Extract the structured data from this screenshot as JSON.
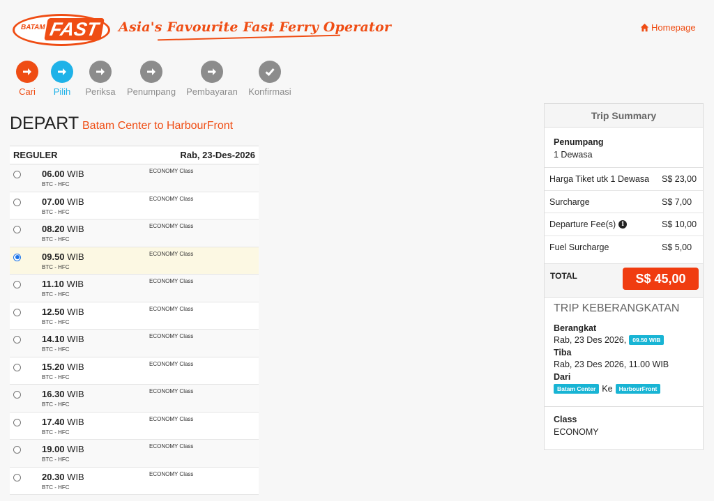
{
  "header": {
    "logo_small": "BATAM",
    "logo_big": "FAST",
    "tagline": "Asia's Favourite Fast Ferry Operator",
    "homepage_label": "Homepage",
    "homepage_icon": "home-icon"
  },
  "steps": [
    {
      "label": "Cari",
      "state": "done",
      "icon": "arrow-right-icon"
    },
    {
      "label": "Pilih",
      "state": "active",
      "icon": "arrow-right-icon"
    },
    {
      "label": "Periksa",
      "state": "pending",
      "icon": "arrow-right-icon"
    },
    {
      "label": "Penumpang",
      "state": "pending",
      "icon": "arrow-right-icon"
    },
    {
      "label": "Pembayaran",
      "state": "pending",
      "icon": "arrow-right-icon"
    },
    {
      "label": "Konfirmasi",
      "state": "pending",
      "icon": "check-icon"
    }
  ],
  "colors": {
    "brand": "#ef4d14",
    "step_active": "#1fb2e8",
    "step_pending": "#8c8c8c",
    "badge": "#18b4d4",
    "selected_row": "#fcf8e3"
  },
  "depart": {
    "title": "DEPART",
    "route": "Batam Center to HarbourFront",
    "table_header_left": "REGULER",
    "table_header_right": "Rab, 23-Des-2026",
    "trips": [
      {
        "time": "06.00",
        "zone": "WIB",
        "route": "BTC - HFC",
        "class": "ECONOMY Class",
        "selected": false
      },
      {
        "time": "07.00",
        "zone": "WIB",
        "route": "BTC - HFC",
        "class": "ECONOMY Class",
        "selected": false
      },
      {
        "time": "08.20",
        "zone": "WIB",
        "route": "BTC - HFC",
        "class": "ECONOMY Class",
        "selected": false
      },
      {
        "time": "09.50",
        "zone": "WIB",
        "route": "BTC - HFC",
        "class": "ECONOMY Class",
        "selected": true
      },
      {
        "time": "11.10",
        "zone": "WIB",
        "route": "BTC - HFC",
        "class": "ECONOMY Class",
        "selected": false
      },
      {
        "time": "12.50",
        "zone": "WIB",
        "route": "BTC - HFC",
        "class": "ECONOMY Class",
        "selected": false
      },
      {
        "time": "14.10",
        "zone": "WIB",
        "route": "BTC - HFC",
        "class": "ECONOMY Class",
        "selected": false
      },
      {
        "time": "15.20",
        "zone": "WIB",
        "route": "BTC - HFC",
        "class": "ECONOMY Class",
        "selected": false
      },
      {
        "time": "16.30",
        "zone": "WIB",
        "route": "BTC - HFC",
        "class": "ECONOMY Class",
        "selected": false
      },
      {
        "time": "17.40",
        "zone": "WIB",
        "route": "BTC - HFC",
        "class": "ECONOMY Class",
        "selected": false
      },
      {
        "time": "19.00",
        "zone": "WIB",
        "route": "BTC - HFC",
        "class": "ECONOMY Class",
        "selected": false
      },
      {
        "time": "20.30",
        "zone": "WIB",
        "route": "BTC - HFC",
        "class": "ECONOMY Class",
        "selected": false
      }
    ]
  },
  "summary": {
    "title": "Trip Summary",
    "passenger_label": "Penumpang",
    "passenger_value": "1 Dewasa",
    "fees": [
      {
        "name": "Harga Tiket utk 1 Dewasa",
        "amount": "S$ 23,00",
        "info": false
      },
      {
        "name": "Surcharge",
        "amount": "S$ 7,00",
        "info": false
      },
      {
        "name": "Departure Fee(s)",
        "amount": "S$ 10,00",
        "info": true
      },
      {
        "name": "Fuel Surcharge",
        "amount": "S$ 5,00",
        "info": false
      }
    ],
    "total_label": "TOTAL",
    "total_value": "S$ 45,00",
    "trip_heading": "TRIP KEBERANGKATAN",
    "depart_label": "Berangkat",
    "depart_value": "Rab, 23 Des 2026,",
    "depart_time_badge": "09.50 WIB",
    "arrive_label": "Tiba",
    "arrive_value": "Rab, 23 Des 2026, 11.00 WIB",
    "from_label": "Dari",
    "from_value": "Batam Center",
    "to_word": "Ke",
    "to_value": "HarbourFront",
    "class_label": "Class",
    "class_value": "ECONOMY"
  }
}
